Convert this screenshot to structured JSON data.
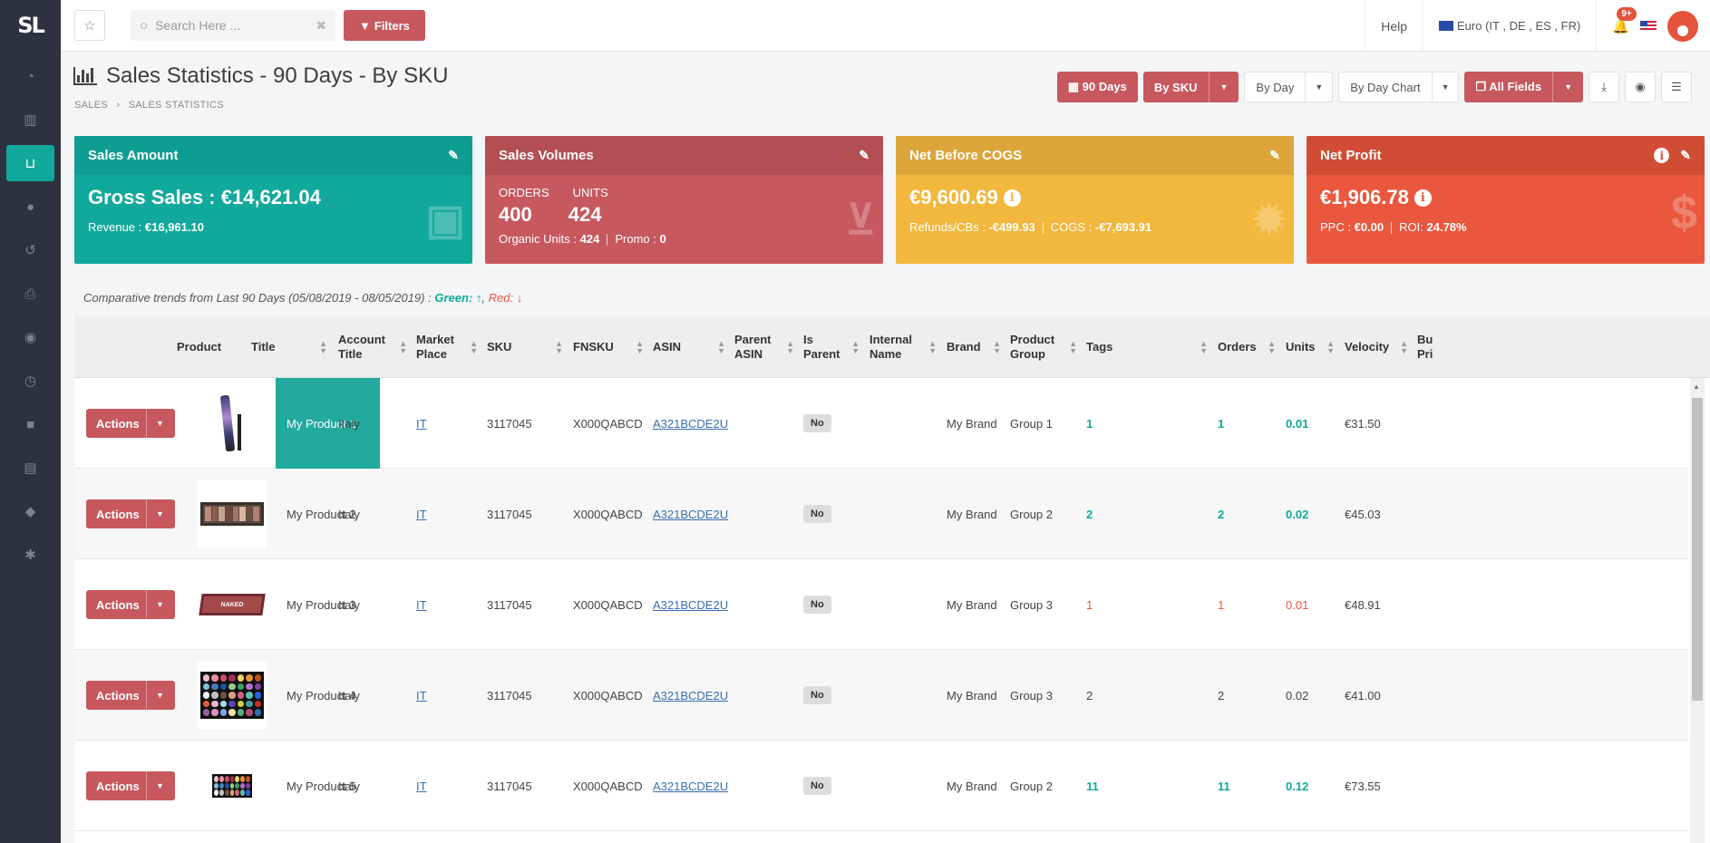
{
  "app": {
    "logo_text": "SL"
  },
  "sidebar": {
    "items": [
      {
        "icon": "dashboard-icon",
        "glyph": "◔"
      },
      {
        "icon": "barcode-icon",
        "glyph": "▥"
      },
      {
        "icon": "basket-icon",
        "glyph": "⊔"
      },
      {
        "icon": "users-icon",
        "glyph": "●"
      },
      {
        "icon": "undo-icon",
        "glyph": "↺"
      },
      {
        "icon": "print-icon",
        "glyph": "⎙"
      },
      {
        "icon": "target-icon",
        "glyph": "◉"
      },
      {
        "icon": "clock-icon",
        "glyph": "◷"
      },
      {
        "icon": "briefcase-icon",
        "glyph": "■"
      },
      {
        "icon": "invoice-icon",
        "glyph": "▤"
      },
      {
        "icon": "tag-icon",
        "glyph": "◆"
      },
      {
        "icon": "gear-icon",
        "glyph": "✱"
      }
    ],
    "active_index": 2
  },
  "topbar": {
    "search_placeholder": "Search Here ...",
    "filters_label": "Filters",
    "help_label": "Help",
    "marketplace_label": "Euro (IT , DE , ES , FR)",
    "notifications_badge": "9+"
  },
  "page": {
    "title": "Sales Statistics - 90 Days - By SKU",
    "breadcrumb": [
      "SALES",
      "SALES STATISTICS"
    ]
  },
  "toolbar": {
    "days_label": "90 Days",
    "group_label": "By SKU",
    "period_label": "By Day",
    "chart_label": "By Day Chart",
    "fields_label": "All Fields"
  },
  "cards": {
    "sales_amount": {
      "title": "Sales Amount",
      "main": "Gross Sales : €14,621.04",
      "revenue_label": "Revenue :",
      "revenue_value": "€16,961.10"
    },
    "sales_volumes": {
      "title": "Sales Volumes",
      "orders_label": "ORDERS",
      "units_label": "UNITS",
      "orders_value": "400",
      "units_value": "424",
      "organic_label": "Organic Units :",
      "organic_value": "424",
      "promo_label": "Promo :",
      "promo_value": "0"
    },
    "net_before_cogs": {
      "title": "Net Before COGS",
      "main": "€9,600.69",
      "refunds_label": "Refunds/CBs :",
      "refunds_value": "-€499.93",
      "cogs_label": "COGS :",
      "cogs_value": "-€7,693.91"
    },
    "net_profit": {
      "title": "Net Profit",
      "main": "€1,906.78",
      "ppc_label": "PPC :",
      "ppc_value": "€0.00",
      "roi_label": "ROI:",
      "roi_value": "24.78%"
    }
  },
  "trends": {
    "text": "Comparative trends from Last 90 Days (05/08/2019 - 08/05/2019) :",
    "green_label": "Green:",
    "red_label": "Red:"
  },
  "table": {
    "columns": [
      "Product",
      "Title",
      "Account Title",
      "Market Place",
      "SKU",
      "FNSKU",
      "ASIN",
      "Parent ASIN",
      "Is Parent",
      "Internal Name",
      "Brand",
      "Product Group",
      "Tags",
      "Orders",
      "Units",
      "Velocity",
      "Bu Pri"
    ],
    "actions_label": "Actions",
    "rows": [
      {
        "title": "My Product 1",
        "account": "Italy",
        "market": "IT",
        "sku": "3117045",
        "fnsku": "X000QABCD",
        "asin": "A321BCDE2U",
        "is_parent": "No",
        "brand": "My Brand",
        "group": "Group 1",
        "tags": "1",
        "orders": "1",
        "units": "0.01",
        "velocity": "€31.50",
        "trend": "green",
        "highlight": true
      },
      {
        "title": "My Product 2",
        "account": "Italy",
        "market": "IT",
        "sku": "3117045",
        "fnsku": "X000QABCD",
        "asin": "A321BCDE2U",
        "is_parent": "No",
        "brand": "My Brand",
        "group": "Group 2",
        "tags": "2",
        "orders": "2",
        "units": "0.02",
        "velocity": "€45.03",
        "trend": "green"
      },
      {
        "title": "My Product 3",
        "account": "Italy",
        "market": "IT",
        "sku": "3117045",
        "fnsku": "X000QABCD",
        "asin": "A321BCDE2U",
        "is_parent": "No",
        "brand": "My Brand",
        "group": "Group 3",
        "tags": "1",
        "orders": "1",
        "units": "0.01",
        "velocity": "€48.91",
        "trend": "red"
      },
      {
        "title": "My Product 4",
        "account": "Italy",
        "market": "IT",
        "sku": "3117045",
        "fnsku": "X000QABCD",
        "asin": "A321BCDE2U",
        "is_parent": "No",
        "brand": "My Brand",
        "group": "Group 3",
        "tags": "2",
        "orders": "2",
        "units": "0.02",
        "velocity": "€41.00",
        "trend": "none"
      },
      {
        "title": "My Product 5",
        "account": "Italy",
        "market": "IT",
        "sku": "3117045",
        "fnsku": "X000QABCD",
        "asin": "A321BCDE2U",
        "is_parent": "No",
        "brand": "My Brand",
        "group": "Group 2",
        "tags": "11",
        "orders": "11",
        "units": "0.12",
        "velocity": "€73.55",
        "trend": "green"
      }
    ]
  },
  "colors": {
    "teal": "#11a99b",
    "rose": "#c7585e",
    "amber": "#f2b73d",
    "orange_red": "#e9583e",
    "sidebar": "#2c3240"
  }
}
